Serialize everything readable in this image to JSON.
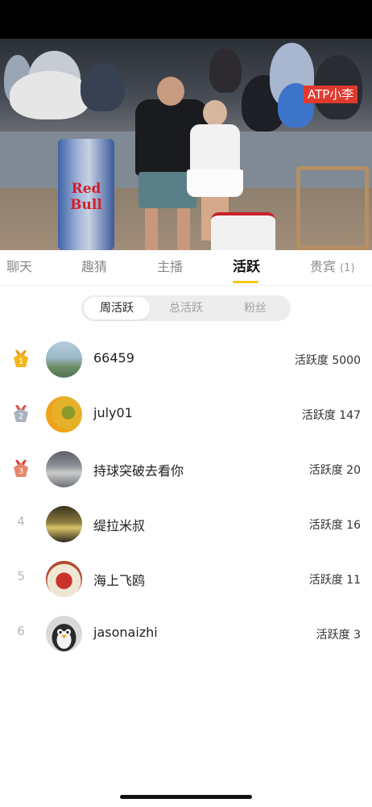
{
  "video": {
    "badge": "ATP小李",
    "can_label": "Red Bull"
  },
  "tabs": [
    {
      "label": "聊天",
      "active": false
    },
    {
      "label": "趣猜",
      "active": false
    },
    {
      "label": "主播",
      "active": false
    },
    {
      "label": "活跃",
      "active": true
    },
    {
      "label": "贵宾",
      "count": "(1)",
      "active": false
    }
  ],
  "segment": {
    "items": [
      "周活跃",
      "总活跃",
      "粉丝"
    ],
    "selected": "周活跃"
  },
  "ranking": [
    {
      "rank": "1",
      "name": "66459",
      "score": "活跃度 5000",
      "medal": "gold",
      "avatar": "beach-avatar"
    },
    {
      "rank": "2",
      "name": "july01",
      "score": "活跃度 147",
      "medal": "silver",
      "avatar": "tennis-ball-avatar"
    },
    {
      "rank": "3",
      "name": "持球突破去看你",
      "score": "活跃度 20",
      "medal": "bronze",
      "avatar": "street-avatar"
    },
    {
      "rank": "4",
      "name": "缇拉米叔",
      "score": "活跃度 16",
      "medal": "none",
      "avatar": "room-avatar"
    },
    {
      "rank": "5",
      "name": "海上飞鸥",
      "score": "活跃度 11",
      "medal": "none",
      "avatar": "sign-avatar"
    },
    {
      "rank": "6",
      "name": "jasonaizhi",
      "score": "活跃度 3",
      "medal": "none",
      "avatar": "penguin-avatar"
    }
  ],
  "colors": {
    "accent": "#f5c518",
    "badge_red": "#e03a2f",
    "gold": "#f3b61f",
    "silver": "#a9b3c0",
    "bronze": "#e5866b"
  }
}
